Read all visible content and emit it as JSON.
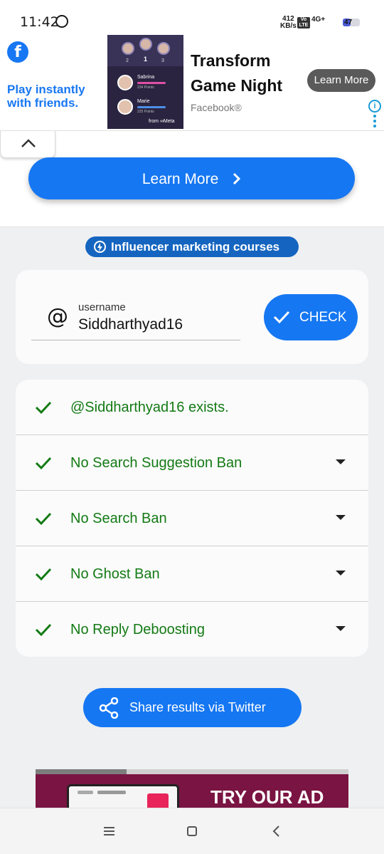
{
  "status_bar": {
    "time": "11:42",
    "speed_value": "412",
    "speed_unit": "KB/s",
    "volte": "Vo LTE",
    "network": "4G+",
    "battery": "47",
    "battery_level": 0.47
  },
  "ad": {
    "logo_letter": "f",
    "tagline": "Play instantly with friends.",
    "title": "Transform Game Night",
    "source": "Facebook®",
    "cta": "Learn More",
    "info": "i",
    "game": {
      "ranks": [
        "2",
        "1",
        "3"
      ],
      "players": [
        {
          "name": "Sabrina",
          "points": "234 Points"
        },
        {
          "name": "Marie",
          "points": "225 Points"
        }
      ],
      "meta": "from ∞Meta"
    }
  },
  "learn_more": {
    "label": "Learn More"
  },
  "pill": {
    "label": "Influencer marketing courses"
  },
  "user_form": {
    "label": "username",
    "value": "Siddharthyad16",
    "check_label": "CHECK"
  },
  "results": [
    {
      "label": "@Siddharthyad16 exists.",
      "expandable": false
    },
    {
      "label": "No Search Suggestion Ban",
      "expandable": true
    },
    {
      "label": "No Search Ban",
      "expandable": true
    },
    {
      "label": "No Ghost Ban",
      "expandable": true
    },
    {
      "label": "No Reply Deboosting",
      "expandable": true
    }
  ],
  "share": {
    "label": "Share results via Twitter"
  },
  "bottom_ad": {
    "text": "TRY OUR AD",
    "progress": 0.29
  },
  "colors": {
    "primary": "#1677f2",
    "success": "#137a13",
    "pill": "#1565c0",
    "ad_tagline": "#1877f2",
    "bottom_ad_bg": "#7a1442"
  }
}
